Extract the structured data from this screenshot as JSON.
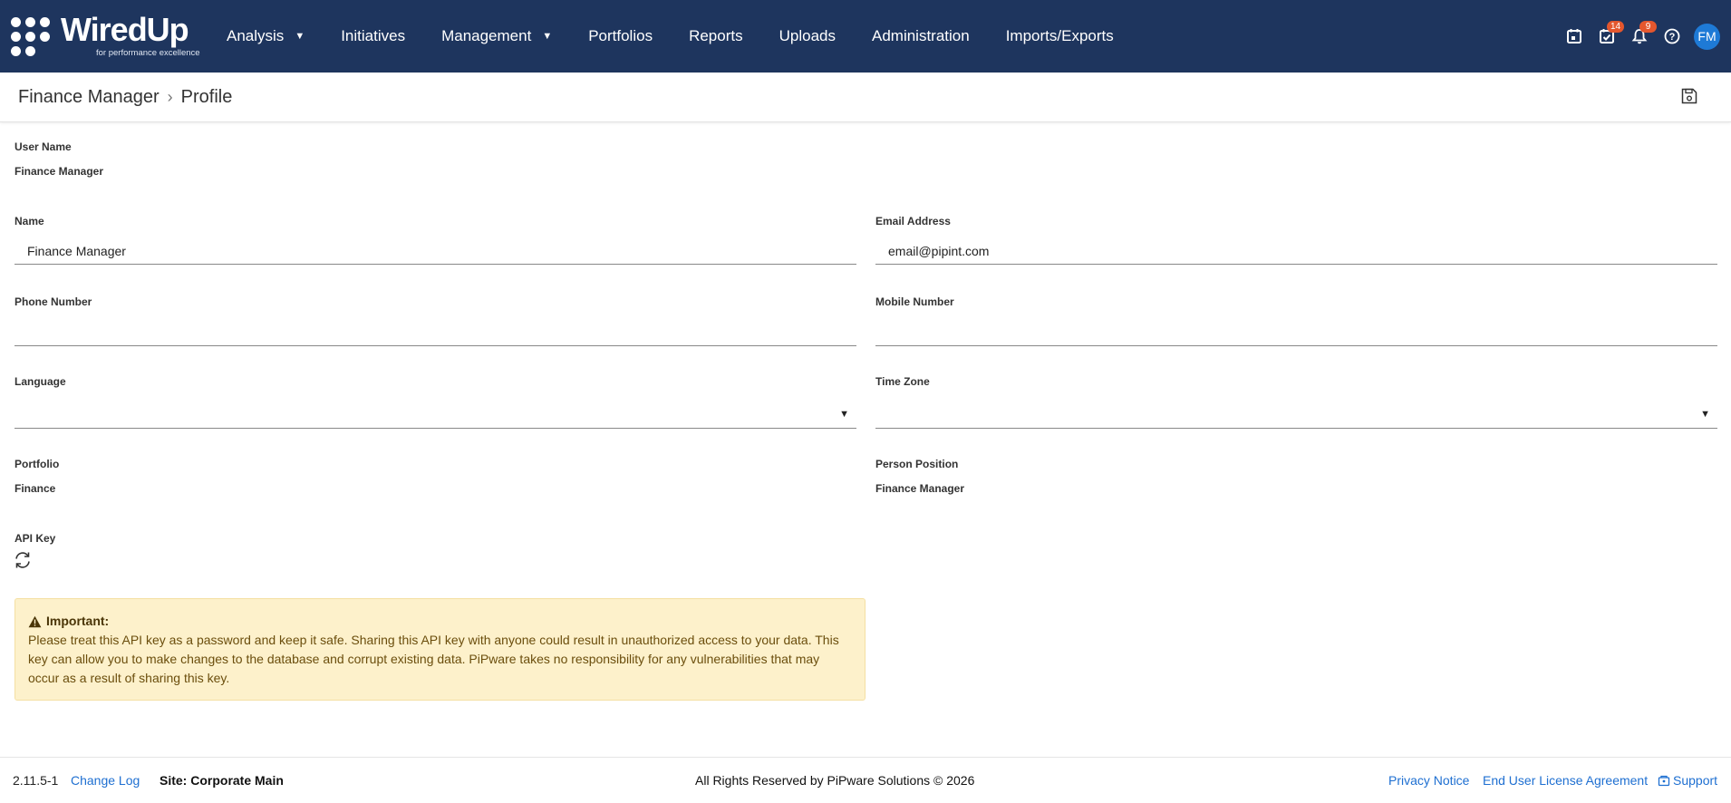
{
  "app": {
    "logo_text": "WiredUp",
    "logo_tagline": "for performance excellence"
  },
  "nav": {
    "items": [
      {
        "label": "Analysis",
        "has_menu": true
      },
      {
        "label": "Initiatives",
        "has_menu": false
      },
      {
        "label": "Management",
        "has_menu": true
      },
      {
        "label": "Portfolios",
        "has_menu": false
      },
      {
        "label": "Reports",
        "has_menu": false
      },
      {
        "label": "Uploads",
        "has_menu": false
      },
      {
        "label": "Administration",
        "has_menu": false
      },
      {
        "label": "Imports/Exports",
        "has_menu": false
      }
    ],
    "icons": {
      "calendar": "calendar-icon",
      "tasks": "task-check-icon",
      "tasks_count": "14",
      "notifications": "bell-icon",
      "notifications_count": "9",
      "help": "help-icon"
    },
    "avatar_initials": "FM"
  },
  "breadcrumb": {
    "parent": "Finance Manager",
    "current": "Profile",
    "save_icon": "save-icon"
  },
  "form": {
    "user_name_label": "User Name",
    "user_name_value": "Finance Manager",
    "name_label": "Name",
    "name_value": "Finance Manager",
    "email_label": "Email Address",
    "email_value": "email@pipint.com",
    "phone_label": "Phone Number",
    "phone_value": "",
    "mobile_label": "Mobile Number",
    "mobile_value": "",
    "language_label": "Language",
    "language_value": "",
    "timezone_label": "Time Zone",
    "timezone_value": "",
    "portfolio_label": "Portfolio",
    "portfolio_value": "Finance",
    "position_label": "Person Position",
    "position_value": "Finance Manager",
    "api_key_label": "API Key",
    "api_key_icon": "refresh-icon"
  },
  "warning": {
    "title": "Important:",
    "text": "Please treat this API key as a password and keep it safe. Sharing this API key with anyone could result in unauthorized access to your data. This key can allow you to make changes to the database and corrupt existing data. PiPware takes no responsibility for any vulnerabilities that may occur as a result of sharing this key."
  },
  "footer": {
    "version": "2.11.5-1",
    "change_log": "Change Log",
    "site": "Site: Corporate Main",
    "copyright": "All Rights Reserved by PiPware Solutions © 2026",
    "privacy": "Privacy Notice",
    "eula": "End User License Agreement",
    "support": "Support"
  },
  "colors": {
    "header_bg": "#1e355e",
    "accent": "#1e7ad6",
    "badge": "#e4572e",
    "warning_bg": "#fdf1cb",
    "link": "#1e6fd1"
  }
}
